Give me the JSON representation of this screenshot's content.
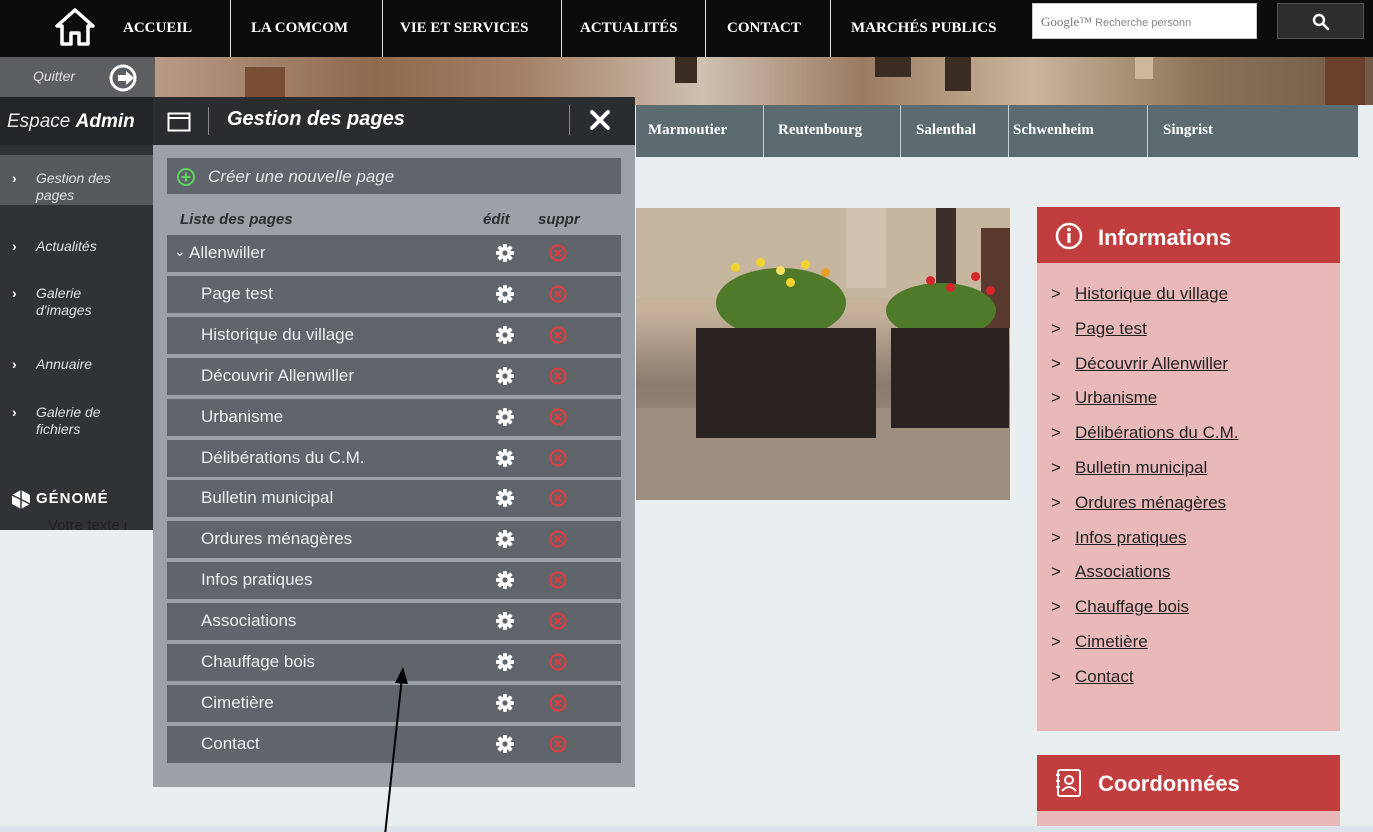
{
  "topnav": {
    "items": [
      "ACCUEIL",
      "LA COMCOM",
      "VIE ET SERVICES",
      "ACTUALITÉS",
      "CONTACT",
      "MARCHÉS PUBLICS"
    ],
    "search_brand": "Google™",
    "search_placeholder": "Recherche personn"
  },
  "admin": {
    "quit_label": "Quitter",
    "header_prefix": "Espace",
    "header_strong": "Admin",
    "sidebar": [
      {
        "line1": "Gestion des",
        "line2": "pages",
        "active": true
      },
      {
        "line1": "Actualités",
        "line2": ""
      },
      {
        "line1": "Galerie",
        "line2": "d'images"
      },
      {
        "line1": "Annuaire",
        "line2": ""
      },
      {
        "line1": "Galerie de",
        "line2": "fichiers"
      }
    ],
    "logo": "GÉNOMÉ"
  },
  "background_text": "Votre texte i",
  "villages": [
    "Marmoutier",
    "Reutenbourg",
    "Salenthal",
    "Schwenheim",
    "Singrist"
  ],
  "panel": {
    "title": "Gestion des pages",
    "create_label": "Créer une nouvelle page",
    "col_list": "Liste des pages",
    "col_edit": "édit",
    "col_delete": "suppr",
    "parent": "Allenwiller",
    "pages": [
      "Page test",
      "Historique du village",
      "Découvrir Allenwiller",
      "Urbanisme",
      "Délibérations du C.M.",
      "Bulletin municipal",
      "Ordures ménagères",
      "Infos pratiques",
      "Associations",
      "Chauffage bois",
      "Cimetière",
      "Contact"
    ]
  },
  "info": {
    "title": "Informations",
    "links": [
      "Historique du village",
      "Page test",
      "Découvrir Allenwiller",
      "Urbanisme",
      "Délibérations du C.M.",
      "Bulletin municipal",
      "Ordures ménagères",
      "Infos pratiques",
      "Associations",
      "Chauffage bois",
      "Cimetière",
      "Contact"
    ]
  },
  "coord": {
    "title": "Coordonnées"
  },
  "colors": {
    "accent_red": "#c23e3e",
    "delete_red": "#e63a3a",
    "panel_bg": "#9ba1a6",
    "row_bg": "#5f656a",
    "nav_bg": "#0c0c0c"
  }
}
